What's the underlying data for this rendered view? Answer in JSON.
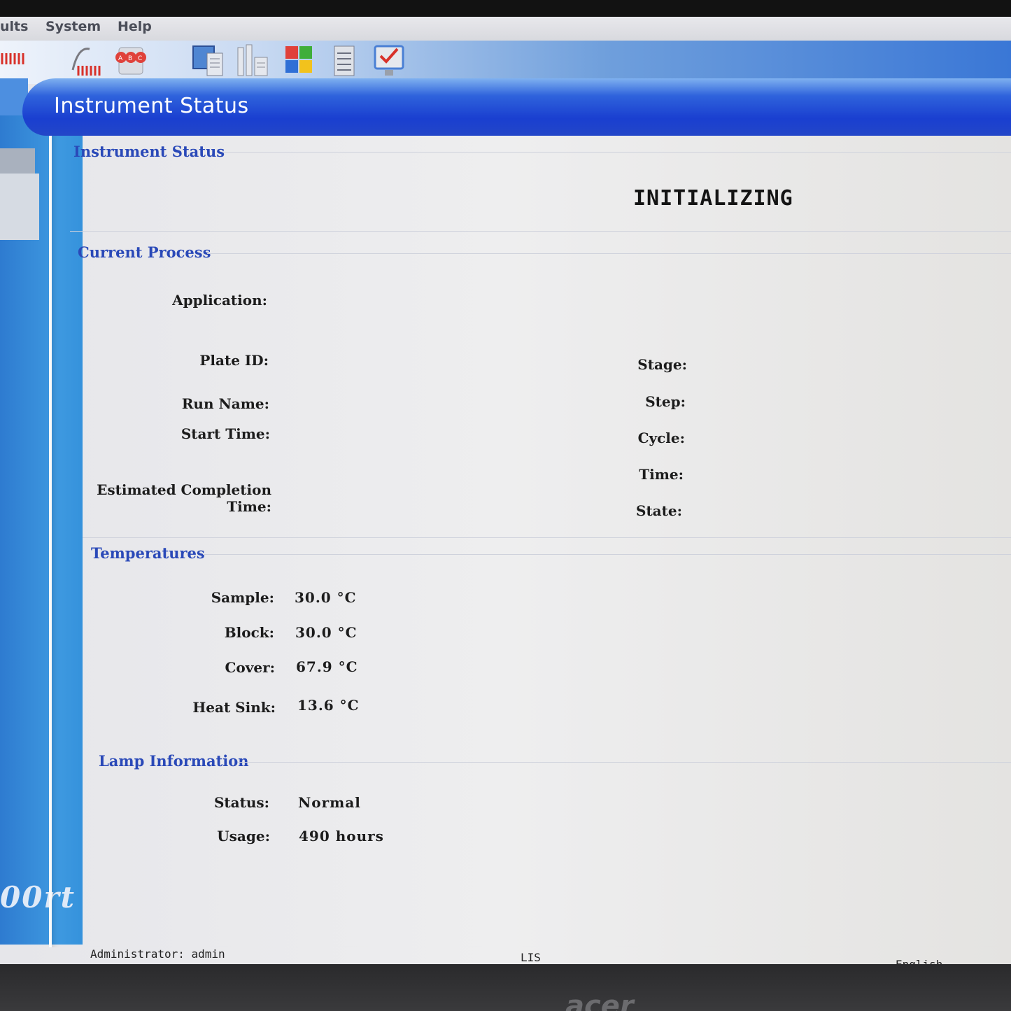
{
  "menu": {
    "results": "ults",
    "system": "System",
    "help": "Help"
  },
  "toolbar": {
    "icons": [
      "thermal-profile-icon",
      "abc-icon",
      "computer-icon",
      "instrument-icon",
      "windows-icon",
      "document-icon",
      "monitor-check-icon"
    ]
  },
  "header": {
    "title": "Instrument Status"
  },
  "sidebar": {
    "logo_text": "00rt"
  },
  "instrument_status": {
    "title": "Instrument Status",
    "state": "INITIALIZING"
  },
  "current_process": {
    "title": "Current Process",
    "application_label": "Application:",
    "plate_id_label": "Plate ID:",
    "run_name_label": "Run Name:",
    "start_time_label": "Start Time:",
    "est_completion_label_1": "Estimated Completion",
    "est_completion_label_2": "Time:",
    "stage_label": "Stage:",
    "step_label": "Step:",
    "cycle_label": "Cycle:",
    "time_label": "Time:",
    "state_label": "State:"
  },
  "temperatures": {
    "title": "Temperatures",
    "sample_label": "Sample:",
    "sample_value": "30.0 °C",
    "block_label": "Block:",
    "block_value": "30.0 °C",
    "cover_label": "Cover:",
    "cover_value": "67.9 °C",
    "heatsink_label": "Heat Sink:",
    "heatsink_value": "13.6 °C"
  },
  "lamp": {
    "title": "Lamp Information",
    "status_label": "Status:",
    "status_value": "Normal",
    "usage_label": "Usage:",
    "usage_value": "490 hours"
  },
  "statusbar": {
    "user": "Administrator: admin",
    "lis": "LIS",
    "language": "English"
  },
  "monitor": {
    "brand": "acer"
  }
}
